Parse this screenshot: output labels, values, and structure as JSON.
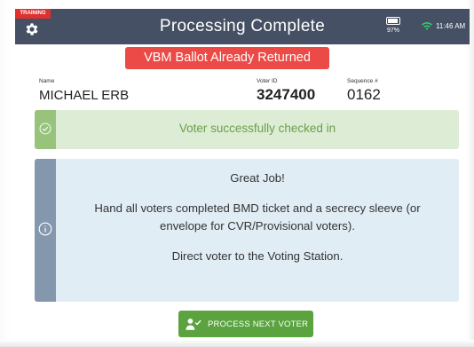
{
  "header": {
    "training_tag": "TRAINING",
    "title": "Processing Complete",
    "battery_percent": "97%",
    "time": "11:46 AM",
    "icons": [
      "gear-icon",
      "battery-icon",
      "wifi-icon"
    ]
  },
  "banner": {
    "text": "VBM Ballot Already Returned",
    "color": "#ec4a46"
  },
  "voter": {
    "name_label": "Name",
    "name": "MICHAEL ERB",
    "voter_id_label": "Voter ID",
    "voter_id": "3247400",
    "sequence_label": "Sequence #",
    "sequence": "0162"
  },
  "status": {
    "text": "Voter successfully checked in",
    "icon": "check-circle-icon",
    "color": "#6aa04a"
  },
  "info": {
    "icon": "info-circle-icon",
    "heading": "Great Job!",
    "line1": "Hand all voters completed BMD ticket and a secrecy sleeve (or",
    "line2": "envelope for CVR/Provisional voters).",
    "line3": "Direct voter to the Voting Station."
  },
  "actions": {
    "next_label": "PROCESS NEXT VOTER",
    "next_icon": "person-check-icon",
    "color": "#5aa33f"
  }
}
